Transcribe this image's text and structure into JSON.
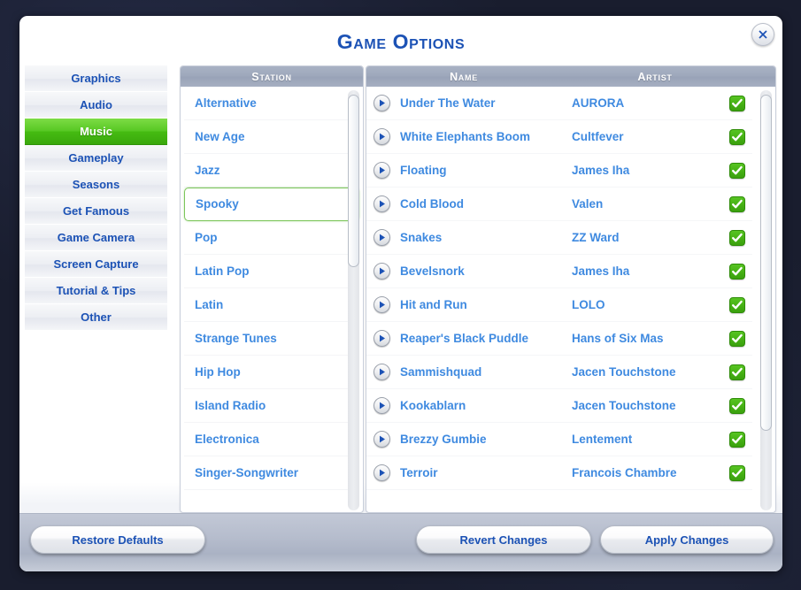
{
  "window": {
    "title": "Game Options",
    "close_icon": "close-x-icon"
  },
  "sidebar": {
    "items": [
      {
        "label": "Graphics",
        "selected": false
      },
      {
        "label": "Audio",
        "selected": false
      },
      {
        "label": "Music",
        "selected": true
      },
      {
        "label": "Gameplay",
        "selected": false
      },
      {
        "label": "Seasons",
        "selected": false
      },
      {
        "label": "Get Famous",
        "selected": false
      },
      {
        "label": "Game Camera",
        "selected": false
      },
      {
        "label": "Screen Capture",
        "selected": false
      },
      {
        "label": "Tutorial & Tips",
        "selected": false
      },
      {
        "label": "Other",
        "selected": false
      }
    ]
  },
  "station_list": {
    "header": "Station",
    "items": [
      {
        "label": "Alternative",
        "selected": false
      },
      {
        "label": "New Age",
        "selected": false
      },
      {
        "label": "Jazz",
        "selected": false
      },
      {
        "label": "Spooky",
        "selected": true
      },
      {
        "label": "Pop",
        "selected": false
      },
      {
        "label": "Latin Pop",
        "selected": false
      },
      {
        "label": "Latin",
        "selected": false
      },
      {
        "label": "Strange Tunes",
        "selected": false
      },
      {
        "label": "Hip Hop",
        "selected": false
      },
      {
        "label": "Island Radio",
        "selected": false
      },
      {
        "label": "Electronica",
        "selected": false
      },
      {
        "label": "Singer-Songwriter",
        "selected": false
      }
    ],
    "scrollbar": {
      "thumb_top_pct": 1,
      "thumb_height_pct": 41
    }
  },
  "song_list": {
    "header_name": "Name",
    "header_artist": "Artist",
    "play_icon": "play-icon",
    "check_icon": "checkmark-icon",
    "rows": [
      {
        "name": "Under The Water",
        "artist": "AURORA",
        "enabled": true
      },
      {
        "name": "White Elephants Boom",
        "artist": "Cultfever",
        "enabled": true
      },
      {
        "name": "Floating",
        "artist": "James Iha",
        "enabled": true
      },
      {
        "name": "Cold Blood",
        "artist": "Valen",
        "enabled": true
      },
      {
        "name": "Snakes",
        "artist": "ZZ Ward",
        "enabled": true
      },
      {
        "name": "Bevelsnork",
        "artist": "James Iha",
        "enabled": true
      },
      {
        "name": "Hit and Run",
        "artist": "LOLO",
        "enabled": true
      },
      {
        "name": "Reaper's Black Puddle",
        "artist": "Hans of Six Mas",
        "enabled": true
      },
      {
        "name": "Sammishquad",
        "artist": "Jacen Touchstone",
        "enabled": true
      },
      {
        "name": "Kookablarn",
        "artist": "Jacen Touchstone",
        "enabled": true
      },
      {
        "name": "Brezzy Gumbie",
        "artist": "Lentement",
        "enabled": true
      },
      {
        "name": "Terroir",
        "artist": "Francois Chambre",
        "enabled": true
      }
    ],
    "scrollbar": {
      "thumb_top_pct": 1,
      "thumb_height_pct": 80
    }
  },
  "footer": {
    "restore_defaults": "Restore Defaults",
    "revert_changes": "Revert Changes",
    "apply_changes": "Apply Changes"
  },
  "colors": {
    "accent_blue": "#1c52b5",
    "link_blue": "#3f8ae0",
    "selected_green": "#45bb12",
    "header_slate": "#9da7bb",
    "backdrop": "#191d2e"
  }
}
